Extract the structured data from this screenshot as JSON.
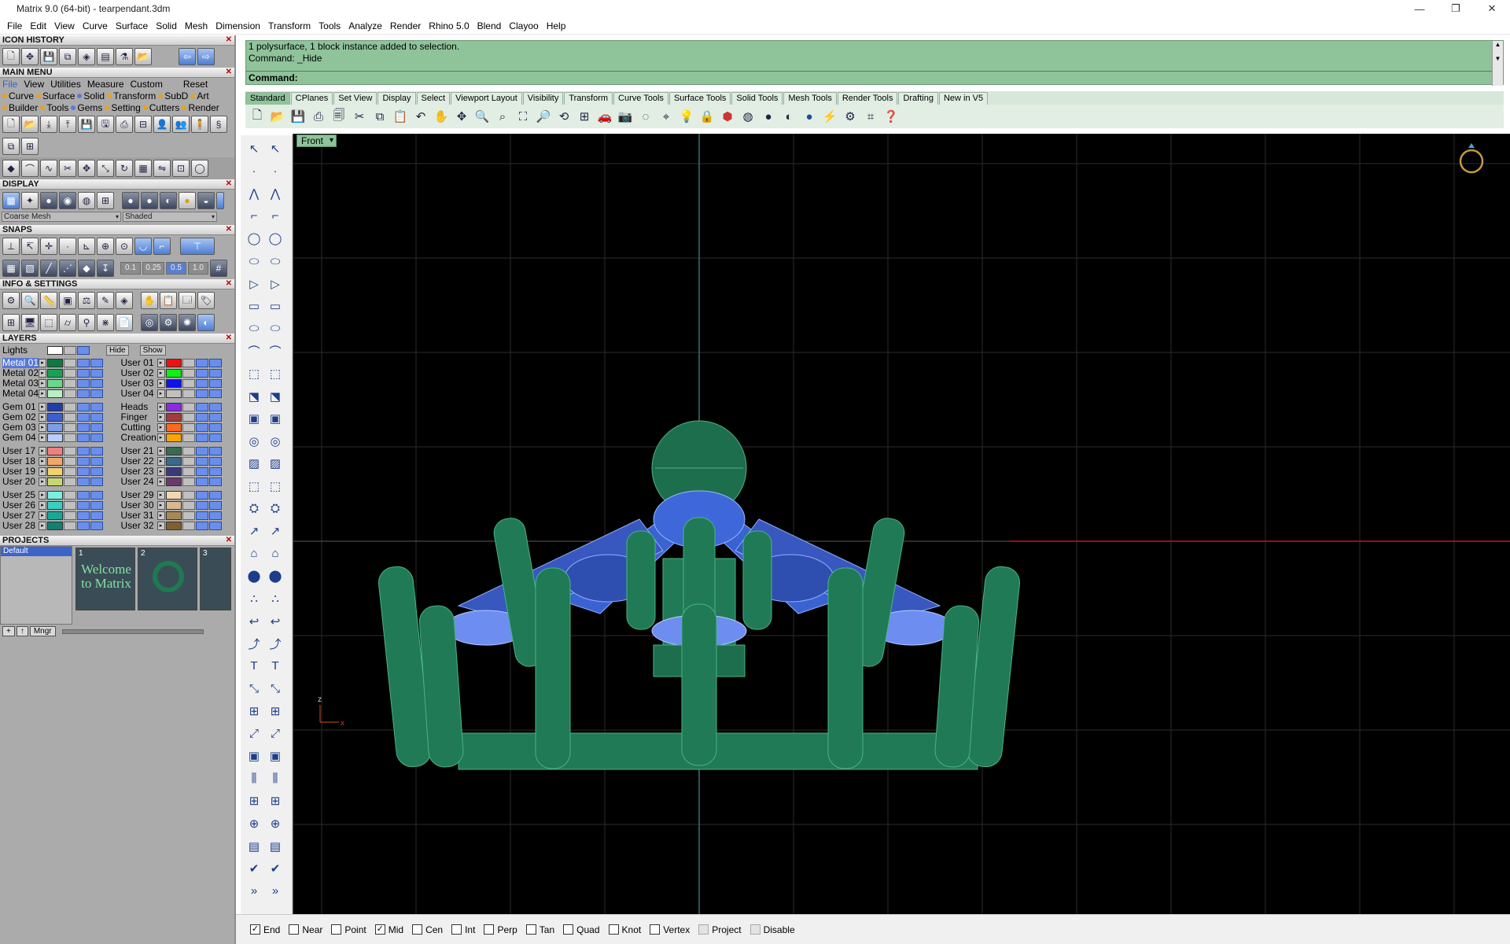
{
  "window": {
    "title": "Matrix 9.0 (64-bit) - tearpendant.3dm",
    "minimize": "—",
    "maximize": "❐",
    "close": "✕"
  },
  "menu": [
    "File",
    "Edit",
    "View",
    "Curve",
    "Surface",
    "Solid",
    "Mesh",
    "Dimension",
    "Transform",
    "Tools",
    "Analyze",
    "Render",
    "Rhino 5.0",
    "Blend",
    "Clayoo",
    "Help"
  ],
  "panels": {
    "icon_history": "ICON HISTORY",
    "main_menu": "MAIN MENU",
    "display": "DISPLAY",
    "snaps": "SNAPS",
    "info_settings": "INFO & SETTINGS",
    "layers": "LAYERS",
    "projects": "PROJECTS"
  },
  "main_menu": {
    "row1": [
      "File",
      "View",
      "Utilities",
      "Measure",
      "Custom",
      "Reset"
    ],
    "row2": [
      "Curve",
      "Surface",
      "Solid",
      "Transform",
      "SubD",
      "Art"
    ],
    "row3": [
      "Builder",
      "Tools",
      "Gems",
      "Setting",
      "Cutters",
      "Render"
    ]
  },
  "display": {
    "mesh_select": "Coarse Mesh",
    "shade_select": "Shaded"
  },
  "snaps": {
    "values": [
      "0.1",
      "0.25",
      "0.5",
      "1.0"
    ],
    "active": "0.5"
  },
  "layers": {
    "lights_label": "Lights",
    "hide_label": "Hide",
    "show_label": "Show",
    "left": [
      {
        "group": [
          {
            "name": "Metal 01",
            "color": "#0d7a42",
            "selected": true
          },
          {
            "name": "Metal 02",
            "color": "#17a254"
          },
          {
            "name": "Metal 03",
            "color": "#6ad88a"
          },
          {
            "name": "Metal 04",
            "color": "#b8f0c4"
          }
        ]
      },
      {
        "group": [
          {
            "name": "Gem 01",
            "color": "#1f3fa8"
          },
          {
            "name": "Gem 02",
            "color": "#3b5fd0"
          },
          {
            "name": "Gem 03",
            "color": "#7a9eea"
          },
          {
            "name": "Gem 04",
            "color": "#b9ceff"
          }
        ]
      },
      {
        "group": [
          {
            "name": "User 17",
            "color": "#f08080"
          },
          {
            "name": "User 18",
            "color": "#f0a868"
          },
          {
            "name": "User 19",
            "color": "#f0d070"
          },
          {
            "name": "User 20",
            "color": "#c8d870"
          }
        ]
      },
      {
        "group": [
          {
            "name": "User 25",
            "color": "#7af0e0"
          },
          {
            "name": "User 26",
            "color": "#38d0c0"
          },
          {
            "name": "User 27",
            "color": "#18a898"
          },
          {
            "name": "User 28",
            "color": "#138070"
          }
        ]
      }
    ],
    "right": [
      {
        "group": [
          {
            "name": "User 01",
            "color": "#ee1111"
          },
          {
            "name": "User 02",
            "color": "#11ee11"
          },
          {
            "name": "User 03",
            "color": "#1111ee"
          },
          {
            "name": "User 04",
            "color": "#c0c0c0"
          }
        ]
      },
      {
        "group": [
          {
            "name": "Heads",
            "color": "#8a2be2"
          },
          {
            "name": "Finger",
            "color": "#a03c3c"
          },
          {
            "name": "Cutting",
            "color": "#ff6a1a"
          },
          {
            "name": "Creation",
            "color": "#ffa500"
          }
        ]
      },
      {
        "group": [
          {
            "name": "User 21",
            "color": "#3a6a50"
          },
          {
            "name": "User 22",
            "color": "#3a6a8a"
          },
          {
            "name": "User 23",
            "color": "#3a3a7a"
          },
          {
            "name": "User 24",
            "color": "#6a3a6a"
          }
        ]
      },
      {
        "group": [
          {
            "name": "User 29",
            "color": "#f0d8b0"
          },
          {
            "name": "User 30",
            "color": "#d8b890"
          },
          {
            "name": "User 31",
            "color": "#a88858"
          },
          {
            "name": "User 32",
            "color": "#806030"
          }
        ]
      }
    ]
  },
  "projects": {
    "list_item": "Default",
    "thumbs": [
      {
        "num": "1",
        "caption": "Welcome to Matrix"
      },
      {
        "num": "2",
        "caption": ""
      },
      {
        "num": "3",
        "caption": ""
      }
    ],
    "mgr_label": "Mngr"
  },
  "command": {
    "line1": "1 polysurface, 1 block instance added to selection.",
    "line2": "Command: _Hide",
    "prompt": "Command:"
  },
  "tabs": [
    "Standard",
    "CPlanes",
    "Set View",
    "Display",
    "Select",
    "Viewport Layout",
    "Visibility",
    "Transform",
    "Curve Tools",
    "Surface Tools",
    "Solid Tools",
    "Mesh Tools",
    "Render Tools",
    "Drafting",
    "New in V5"
  ],
  "active_tab": "Standard",
  "viewport": {
    "name": "Front",
    "axis_z": "z",
    "axis_x": "x"
  },
  "osnaps": [
    {
      "label": "End",
      "checked": true
    },
    {
      "label": "Near",
      "checked": false
    },
    {
      "label": "Point",
      "checked": false
    },
    {
      "label": "Mid",
      "checked": true
    },
    {
      "label": "Cen",
      "checked": false
    },
    {
      "label": "Int",
      "checked": false
    },
    {
      "label": "Perp",
      "checked": false
    },
    {
      "label": "Tan",
      "checked": false
    },
    {
      "label": "Quad",
      "checked": false
    },
    {
      "label": "Knot",
      "checked": false
    },
    {
      "label": "Vertex",
      "checked": false
    },
    {
      "label": "Project",
      "checked": false,
      "disabled": true
    },
    {
      "label": "Disable",
      "checked": false,
      "disabled": true
    }
  ],
  "colors": {
    "command_bg": "#8fc39a",
    "metal": "#1f7a55",
    "gem": "#4a6fe0",
    "viewport_bg": "#000000"
  }
}
